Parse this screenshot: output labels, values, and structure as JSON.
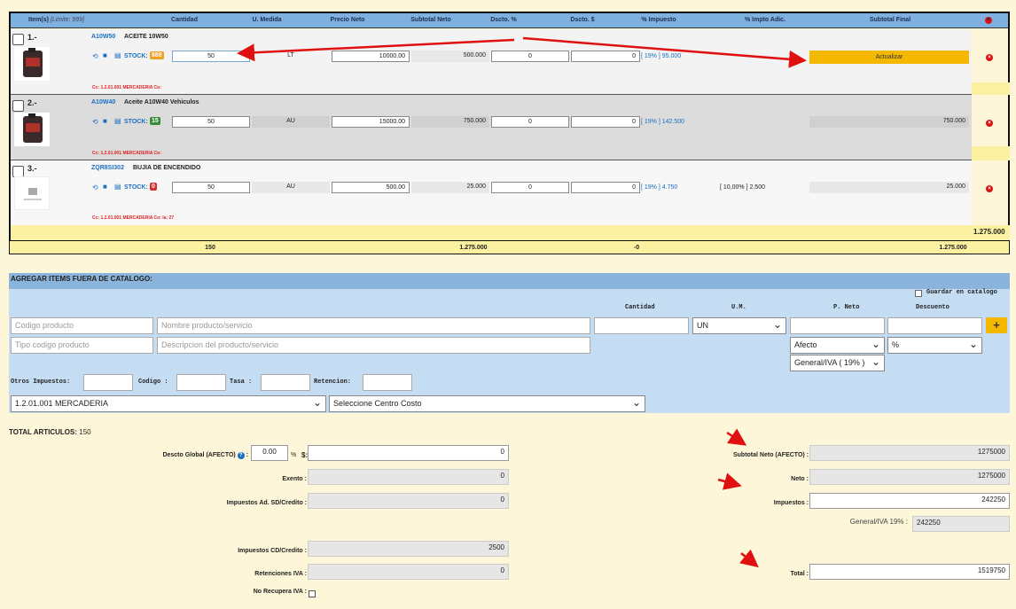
{
  "header": {
    "items": "Item(s)",
    "limit": "[Limite: 999]",
    "cantidad": "Cantidad",
    "umedida": "U. Medida",
    "precio_neto": "Precio Neto",
    "subtotal_neto": "Subtotal Neto",
    "dscto_pct": "Dscto. %",
    "dscto_amt": "Dscto. $",
    "pct_impuesto": "% Impuesto",
    "pct_impto_adic": "% Impto Adic.",
    "subtotal_final": "Subtotal Final"
  },
  "rows": [
    {
      "num": "1.-",
      "code": "A10W50",
      "name": "ACEITE 10W50",
      "stock_label": "STOCK:",
      "stock": "888",
      "stock_color": "#f0a020",
      "cantidad": "50",
      "um": "LT",
      "precio": "10000.00",
      "subtotal": "500.000",
      "dpct": "0",
      "damt": "0",
      "iva": "[ 19% ] 95.000",
      "adic": "",
      "final_btn": "Actualizar",
      "cc": "Cc: 1.2.01.001 MERCADERIA Co:"
    },
    {
      "num": "2.-",
      "code": "A10W40",
      "name": "Aceite A10W40 Vehiculos",
      "stock_label": "STOCK:",
      "stock": "15",
      "stock_color": "#3a8a3a",
      "cantidad": "50",
      "um": "AU",
      "precio": "15000.00",
      "subtotal": "750.000",
      "dpct": "0",
      "damt": "0",
      "iva": "[ 19% ] 142.500",
      "adic": "",
      "final": "750.000",
      "cc": "Cc: 1.2.01.001 MERCADERIA Co:"
    },
    {
      "num": "3.-",
      "code": "ZQR8SI302",
      "name": "BUJIA DE ENCENDIDO",
      "stock_label": "STOCK:",
      "stock": "0",
      "stock_color": "#d23030",
      "cantidad": "50",
      "um": "AU",
      "precio": "500.00",
      "subtotal": "25.000",
      "dpct": "0",
      "damt": "0",
      "iva": "[ 19% ] 4.750",
      "adic": "[ 10,00% ] 2.500",
      "final": "25.000",
      "cc": "Cc: 1.2.01.001 MERCADERIA Co: la: 27"
    }
  ],
  "grand_final": "1.275.000",
  "totals": {
    "cantidad": "150",
    "subtotal": "1.275.000",
    "descuento": "-0",
    "final": "1.275.000"
  },
  "panel": {
    "title": "AGREGAR ITEMS FUERA DE CATALOGO:",
    "guardar": "Guardar en catalogo",
    "col_cantidad": "Cantidad",
    "col_um": "U.M.",
    "col_pneto": "P. Neto",
    "col_descuento": "Descuento",
    "ph_codigo": "Codigo producto",
    "ph_nombre": "Nombre producto/servicio",
    "ph_tipo": "Tipo codigo producto",
    "ph_desc": "Descripcion del producto/servicio",
    "um_value": "UN",
    "afecto_value": "Afecto",
    "pct_value": "%",
    "iva_value": "General/IVA ( 19% )",
    "otros": "Otros Impuestos:",
    "codigo": "Codigo :",
    "tasa": "Tasa :",
    "retencion": "Retencion:",
    "cuenta": "1.2.01.001    MERCADERIA",
    "centro": "Seleccione Centro Costo",
    "add": "+"
  },
  "summary": {
    "total_articulos_label": "TOTAL ARTICULOS:",
    "total_articulos": "150",
    "descto_global_label": "Descto Global (AFECTO)",
    "descto_pct": "0.00",
    "descto_amt": "0",
    "exento_label": "Exento :",
    "exento": "0",
    "imp_ad_label": "Impuestos Ad. SD/Credito :",
    "imp_ad": "0",
    "imp_cd_label": "Impuestos CD/Credito :",
    "imp_cd": "2500",
    "retenciones_label": "Retenciones IVA :",
    "retenciones": "0",
    "no_recupera_label": "No Recupera IVA :",
    "subtotal_neto_label": "Subtotal Neto (AFECTO) :",
    "subtotal_neto": "1275000",
    "neto_label": "Neto :",
    "neto": "1275000",
    "impuestos_label": "Impuestos :",
    "impuestos": "242250",
    "iva_label": "General/IVA 19% :",
    "iva": "242250",
    "total_label": "Total :",
    "total": "1519750"
  },
  "colors": {
    "header": "#7eb0e0",
    "panel": "#c5ddf2",
    "accent": "#f5b800",
    "arrow": "#e01010"
  }
}
